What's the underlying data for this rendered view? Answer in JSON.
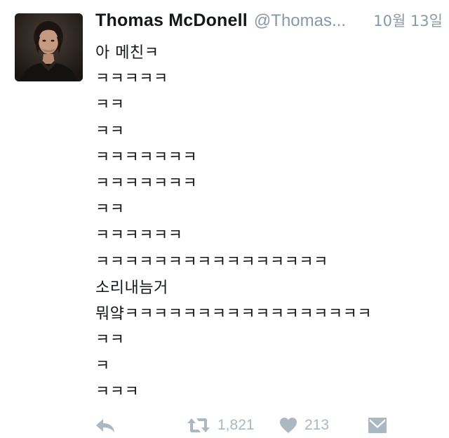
{
  "tweet": {
    "author": {
      "display_name": "Thomas McDonell",
      "handle": "@Thomas...",
      "avatar_icon": "profile-photo"
    },
    "timestamp": "10월 13일",
    "lines": [
      "아 메친ㅋ",
      "ㅋㅋㅋㅋㅋ",
      "ㅋㅋ",
      "ㅋㅋ",
      "ㅋㅋㅋㅋㅋㅋㅋ",
      "ㅋㅋㅋㅋㅋㅋㅋ",
      "ㅋㅋ",
      "ㅋㅋㅋㅋㅋㅋ",
      "ㅋㅋㅋㅋㅋㅋㅋㅋㅋㅋㅋㅋㅋㅋㅋㅋ",
      "소리내늠거",
      "뭐얔ㅋㅋㅋㅋㅋㅋㅋㅋㅋㅋㅋㅋㅋㅋㅋㅋㅋ",
      "ㅋㅋ",
      "ㅋ",
      "ㅋㅋㅋ"
    ],
    "actions": {
      "reply_icon": "reply-arrow-icon",
      "retweet_icon": "retweet-icon",
      "retweet_count": "1,821",
      "like_icon": "heart-icon",
      "like_count": "213",
      "dm_icon": "envelope-icon"
    }
  },
  "colors": {
    "text": "#14171a",
    "muted": "#8899a6",
    "action_icon": "#aab8c2",
    "background": "#ffffff"
  }
}
